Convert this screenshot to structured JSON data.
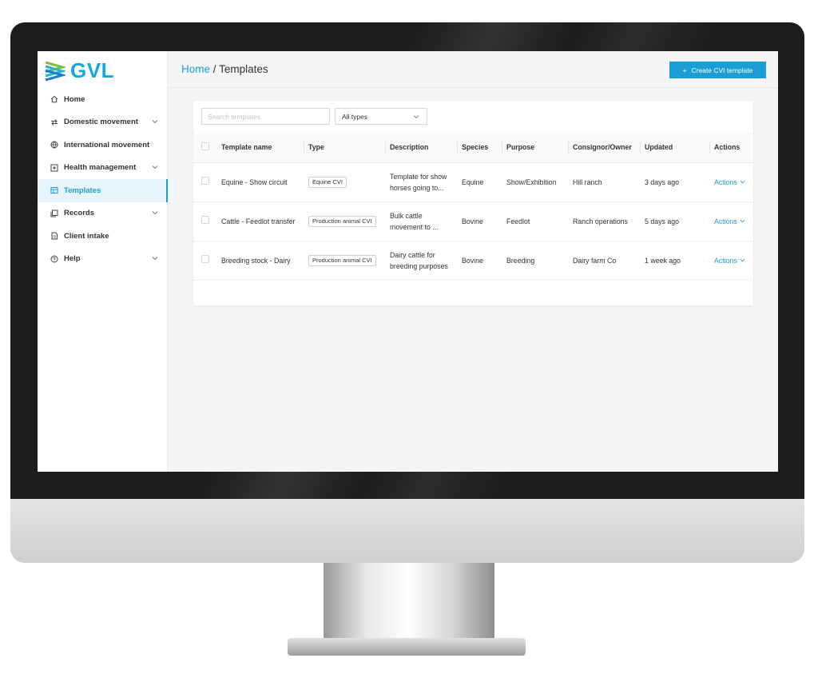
{
  "brand": {
    "name": "GVL",
    "logo_icon": "stacked-chevrons-logo",
    "accent": "#1b9ed6"
  },
  "sidebar": {
    "items": [
      {
        "label": "Home",
        "icon": "home-icon",
        "expandable": false
      },
      {
        "label": "Domestic movement",
        "icon": "swap-arrows-icon",
        "expandable": true
      },
      {
        "label": "International movement",
        "icon": "globe-icon",
        "expandable": false
      },
      {
        "label": "Health management",
        "icon": "plus-square-icon",
        "expandable": true
      },
      {
        "label": "Templates",
        "icon": "template-icon",
        "expandable": false,
        "active": true
      },
      {
        "label": "Records",
        "icon": "records-icon",
        "expandable": true
      },
      {
        "label": "Client intake",
        "icon": "document-icon",
        "expandable": false
      },
      {
        "label": "Help",
        "icon": "help-circle-icon",
        "expandable": true
      }
    ]
  },
  "header": {
    "breadcrumb_home": "Home",
    "breadcrumb_sep": "/",
    "breadcrumb_current": "Templates",
    "create_button": "Create CVI template",
    "create_icon": "+"
  },
  "filters": {
    "search_placeholder": "Search templates",
    "type_select": "All types"
  },
  "table": {
    "columns": [
      "Template name",
      "Type",
      "Description",
      "Species",
      "Purpose",
      "Consignor/Owner",
      "Updated",
      "Actions"
    ],
    "rows": [
      {
        "name": "Equine - Show circuit",
        "type": "Equine CVI",
        "description": "Template for show horses going to...",
        "species": "Equine",
        "purpose": "Show/Exhibition",
        "owner": "Hill ranch",
        "updated": "3 days ago",
        "action": "Actions"
      },
      {
        "name": "Cattle - Feedlot transfer",
        "type": "Production animal CVI",
        "description": "Bulk cattle movement to ...",
        "species": "Bovine",
        "purpose": "Feedlot",
        "owner": "Ranch operations",
        "updated": "5 days ago",
        "action": "Actions"
      },
      {
        "name": "Breeding stock - Dairy",
        "type": "Production animal CVI",
        "description": "Dairy cattle for breeding purposes",
        "species": "Bovine",
        "purpose": "Breeding",
        "owner": "Dairy farm Co",
        "updated": "1 week ago",
        "action": "Actions"
      }
    ]
  }
}
